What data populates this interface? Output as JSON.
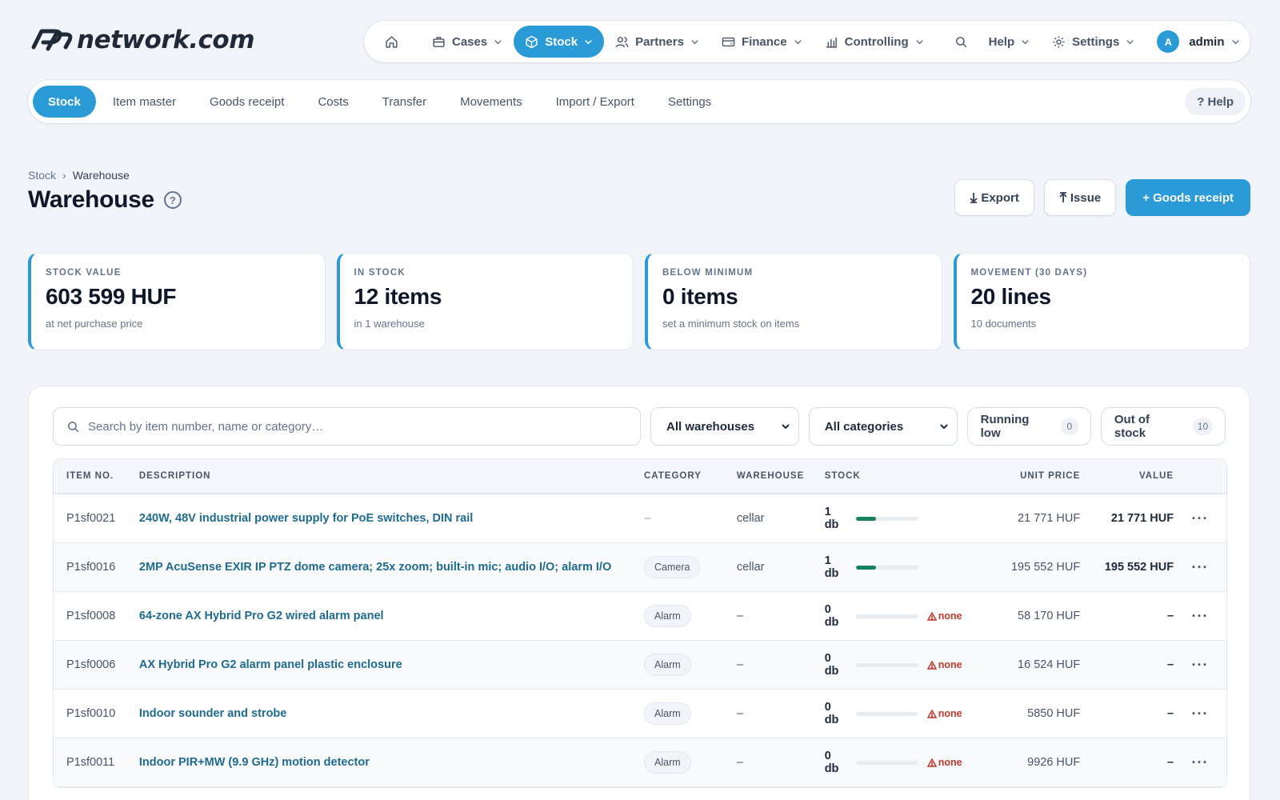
{
  "brand": {
    "logo_text": "network.com"
  },
  "topnav": {
    "home_label": "",
    "items": [
      {
        "label": "Cases",
        "icon": "briefcase-icon"
      },
      {
        "label": "Stock",
        "icon": "box-icon",
        "active": true
      },
      {
        "label": "Partners",
        "icon": "users-icon"
      },
      {
        "label": "Finance",
        "icon": "wallet-icon"
      },
      {
        "label": "Controlling",
        "icon": "chart-icon"
      }
    ],
    "help_label": "Help",
    "settings_label": "Settings",
    "user": {
      "avatar_letter": "A",
      "name": "admin"
    }
  },
  "subnav": {
    "items": [
      "Stock",
      "Item master",
      "Goods receipt",
      "Costs",
      "Transfer",
      "Movements",
      "Import / Export",
      "Settings"
    ],
    "active_index": 0,
    "help_label": "? Help"
  },
  "breadcrumb": {
    "root": "Stock",
    "separator": "›",
    "current": "Warehouse"
  },
  "page": {
    "title": "Warehouse",
    "help_mark": "?"
  },
  "actions": {
    "export_label": "Export",
    "issue_label": "Issue",
    "goods_receipt_label": "+ Goods receipt"
  },
  "stats": [
    {
      "label": "STOCK VALUE",
      "value": "603 599 HUF",
      "sub": "at net purchase price"
    },
    {
      "label": "IN STOCK",
      "value": "12 items",
      "sub": "in 1 warehouse"
    },
    {
      "label": "BELOW MINIMUM",
      "value": "0 items",
      "sub": "set a minimum stock on items"
    },
    {
      "label": "MOVEMENT (30 DAYS)",
      "value": "20 lines",
      "sub": "10 documents"
    }
  ],
  "filters": {
    "search_placeholder": "Search by item number, name or category…",
    "warehouse_select": "All warehouses",
    "category_select": "All categories",
    "running_low_label": "Running low",
    "running_low_count": "0",
    "out_of_stock_label": "Out of stock",
    "out_of_stock_count": "10"
  },
  "table": {
    "headers": {
      "item_no": "ITEM NO.",
      "description": "DESCRIPTION",
      "category": "CATEGORY",
      "warehouse": "WAREHOUSE",
      "stock": "STOCK",
      "unit_price": "UNIT PRICE",
      "value": "VALUE"
    },
    "rows": [
      {
        "item_no": "P1sf0021",
        "description": "240W, 48V industrial power supply for PoE switches, DIN rail",
        "category": "–",
        "warehouse": "cellar",
        "stock": "1 db",
        "stock_level": 0.33,
        "warning": "",
        "unit_price": "21 771 HUF",
        "value": "21 771 HUF"
      },
      {
        "item_no": "P1sf0016",
        "description": "2MP AcuSense EXIR IP PTZ dome camera; 25x zoom; built-in mic; audio I/O; alarm I/O",
        "category": "Camera",
        "warehouse": "cellar",
        "stock": "1 db",
        "stock_level": 0.33,
        "warning": "",
        "unit_price": "195 552 HUF",
        "value": "195 552 HUF"
      },
      {
        "item_no": "P1sf0008",
        "description": "64-zone AX Hybrid Pro G2 wired alarm panel",
        "category": "Alarm",
        "warehouse": "–",
        "stock": "0 db",
        "stock_level": 0,
        "warning": "none",
        "unit_price": "58 170 HUF",
        "value": "–"
      },
      {
        "item_no": "P1sf0006",
        "description": "AX Hybrid Pro G2 alarm panel plastic enclosure",
        "category": "Alarm",
        "warehouse": "–",
        "stock": "0 db",
        "stock_level": 0,
        "warning": "none",
        "unit_price": "16 524 HUF",
        "value": "–"
      },
      {
        "item_no": "P1sf0010",
        "description": "Indoor sounder and strobe",
        "category": "Alarm",
        "warehouse": "–",
        "stock": "0 db",
        "stock_level": 0,
        "warning": "none",
        "unit_price": "5850 HUF",
        "value": "–"
      },
      {
        "item_no": "P1sf0011",
        "description": "Indoor PIR+MW (9.9 GHz) motion detector",
        "category": "Alarm",
        "warehouse": "–",
        "stock": "0 db",
        "stock_level": 0,
        "warning": "none",
        "unit_price": "9926 HUF",
        "value": "–"
      }
    ],
    "row_menu_label": "···"
  },
  "colors": {
    "accent": "#2a9bd6",
    "link": "#1f6b8f",
    "stock_bar": "#15825d",
    "warning": "#c0392b"
  }
}
